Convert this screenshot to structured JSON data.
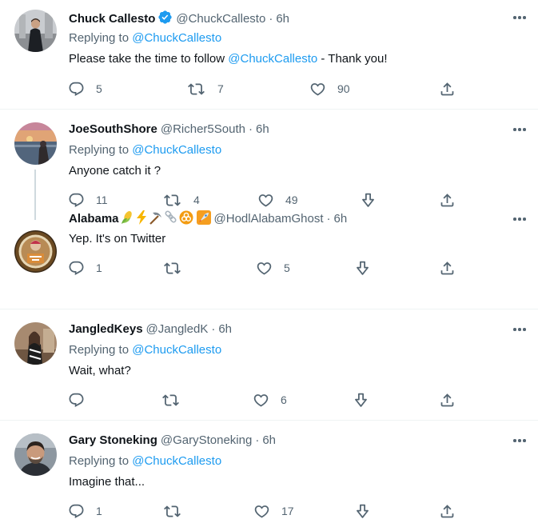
{
  "colors": {
    "text": "#0f1419",
    "secondary": "#536471",
    "accent": "#1d9bf0",
    "divider": "#eff3f4",
    "thread_line": "#cfd9de"
  },
  "reply_prefix": "Replying to",
  "dot": "·",
  "tweets": [
    {
      "name": "Chuck Callesto",
      "verified": true,
      "handle": "@ChuckCallesto",
      "time": "6h",
      "replying_to": "@ChuckCallesto",
      "text_before": "Please take the time to follow ",
      "text_mention": "@ChuckCallesto",
      "text_after": " - Thank you!",
      "replies": "5",
      "retweets": "7",
      "likes": "90",
      "actions": [
        "reply-icon",
        "retweet-icon",
        "like-icon",
        "share-icon"
      ]
    },
    {
      "name": "JoeSouthShore",
      "handle": "@Richer5South",
      "time": "6h",
      "replying_to": "@ChuckCallesto",
      "text": "Anyone catch it ?",
      "replies": "11",
      "retweets": "4",
      "likes": "49",
      "actions": [
        "reply-icon",
        "retweet-icon",
        "like-icon",
        "downvote-icon",
        "share-icon"
      ]
    },
    {
      "name": "Alabama",
      "name_emojis": [
        "corn-emoji",
        "lightning-emoji",
        "pick-emoji",
        "chain-emoji",
        "biohazard-emoji",
        "rocket-emoji"
      ],
      "handle": "@HodlAlabamGhost",
      "time": "6h",
      "text": "Yep.  It's on Twitter",
      "replies": "1",
      "retweets": "",
      "likes": "5",
      "actions": [
        "reply-icon",
        "retweet-icon",
        "like-icon",
        "downvote-icon",
        "share-icon"
      ]
    },
    {
      "name": "JangledKeys",
      "handle": "@JangledK",
      "time": "6h",
      "replying_to": "@ChuckCallesto",
      "text": "Wait, what?",
      "replies": "",
      "retweets": "",
      "likes": "6",
      "actions": [
        "reply-icon",
        "retweet-icon",
        "like-icon",
        "downvote-icon",
        "share-icon"
      ]
    },
    {
      "name": "Gary Stoneking",
      "handle": "@GaryStoneking",
      "time": "6h",
      "replying_to": "@ChuckCallesto",
      "text": "Imagine that...",
      "replies": "1",
      "retweets": "",
      "likes": "17",
      "actions": [
        "reply-icon",
        "retweet-icon",
        "like-icon",
        "downvote-icon",
        "share-icon"
      ]
    }
  ]
}
